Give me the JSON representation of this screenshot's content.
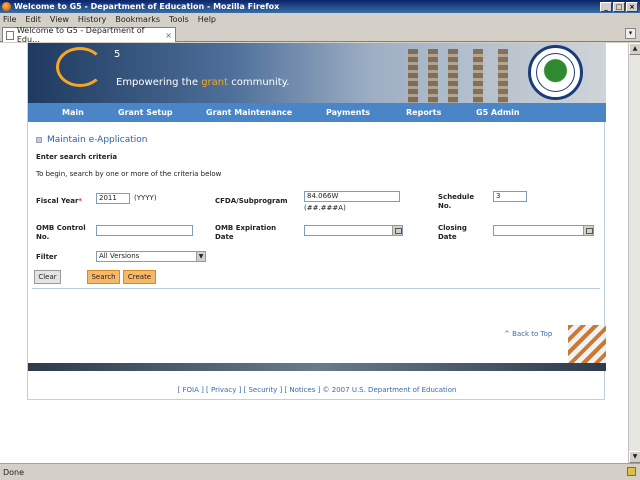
{
  "window": {
    "title": "Welcome to G5 - Department of Education - Mozilla Firefox",
    "controls": {
      "minimize": "_",
      "maximize": "□",
      "close": "×"
    }
  },
  "menu": [
    "File",
    "Edit",
    "View",
    "History",
    "Bookmarks",
    "Tools",
    "Help"
  ],
  "tab": {
    "label": "Welcome to G5 - Department of Edu...",
    "close": "×"
  },
  "banner": {
    "logo": "G",
    "logo_super": "5",
    "tagline_pre": "Empowering the ",
    "tagline_hl": "grant",
    "tagline_post": " community."
  },
  "nav": [
    "Main",
    "Grant Setup",
    "Grant Maintenance",
    "Payments",
    "Reports",
    "G5 Admin"
  ],
  "form": {
    "title": "Maintain e-Application",
    "subhead": "Enter search criteria",
    "hint": "To begin, search by one or more of the criteria below",
    "fiscal_year_label": "Fiscal Year",
    "required_mark": "*",
    "fiscal_year_value": "2011",
    "fiscal_year_format": "(YYYY)",
    "cfda_label": "CFDA/Subprogram",
    "cfda_value": "84.066W",
    "cfda_format": "(##.###A)",
    "schedule_label": "Schedule No.",
    "schedule_value": "3",
    "omb_control_label": "OMB Control No.",
    "omb_control_value": "",
    "omb_exp_label": "OMB Expiration Date",
    "omb_exp_value": "",
    "closing_label": "Closing Date",
    "closing_value": "",
    "filter_label": "Filter",
    "filter_value": "All Versions",
    "clear_btn": "Clear",
    "search_btn": "Search",
    "create_btn": "Create"
  },
  "back_to_top": "^ Back to Top",
  "footer": "[ FOIA ] [ Privacy ] [ Security ] [ Notices ]   ©  2007  U.S.  Department  of  Education",
  "status": "Done"
}
